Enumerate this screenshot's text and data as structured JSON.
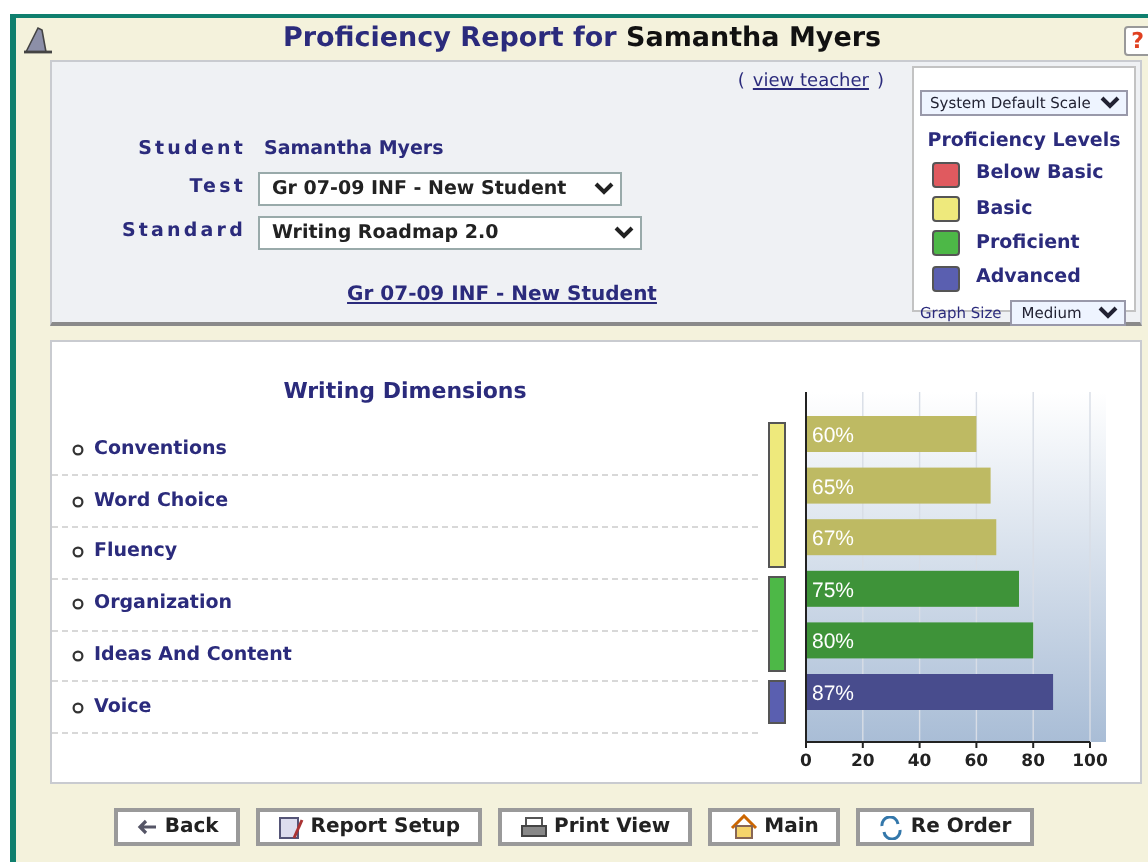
{
  "header": {
    "title": "Proficiency Report for",
    "student_name": "Samantha Myers",
    "help": "?"
  },
  "form": {
    "view_teacher_open": "(",
    "view_teacher": "view teacher",
    "view_teacher_close": ")",
    "fields": [
      {
        "label": "Student",
        "kind": "text",
        "value": "Samantha Myers"
      },
      {
        "label": "Test",
        "kind": "select",
        "value": "Gr 07-09 INF - New Student"
      },
      {
        "label": "Standard",
        "kind": "select",
        "value": "Writing Roadmap 2.0"
      }
    ],
    "test_link": "Gr 07-09 INF - New Student"
  },
  "legend": {
    "scale": "System Default Scale",
    "title": "Proficiency Levels",
    "levels": [
      {
        "label": "Below Basic",
        "color": "#e05a5f"
      },
      {
        "label": "Basic",
        "color": "#eee97c"
      },
      {
        "label": "Proficient",
        "color": "#4db847"
      },
      {
        "label": "Advanced",
        "color": "#5a5fb0"
      }
    ],
    "graph_size_label": "Graph Size",
    "graph_size": "Medium"
  },
  "dimensions": {
    "title": "Writing Dimensions",
    "items": [
      {
        "label": "Conventions",
        "color": "#eee97c"
      },
      {
        "label": "Word Choice",
        "color": "#eee97c"
      },
      {
        "label": "Fluency",
        "color": "#eee97c"
      },
      {
        "label": "Organization",
        "color": "#4db847"
      },
      {
        "label": "Ideas And Content",
        "color": "#4db847"
      },
      {
        "label": "Voice",
        "color": "#5a5fb0"
      }
    ],
    "chart_data": {
      "type": "bar",
      "orientation": "horizontal",
      "series": [
        {
          "values": [
            60,
            65,
            67,
            75,
            80,
            87
          ]
        }
      ],
      "xlim": [
        0,
        100
      ],
      "grid": true,
      "xticks": [
        0,
        20,
        40,
        60,
        80,
        100
      ],
      "value_labels": [
        "60%",
        "65%",
        "67%",
        "75%",
        "80%",
        "87%"
      ]
    }
  },
  "buttons": [
    {
      "label": "Back",
      "kind": "back"
    },
    {
      "label": "Report Setup",
      "kind": "setup"
    },
    {
      "label": "Print View",
      "kind": "print"
    },
    {
      "label": "Main",
      "kind": "home"
    },
    {
      "label": "Re Order",
      "kind": "reorder"
    }
  ]
}
